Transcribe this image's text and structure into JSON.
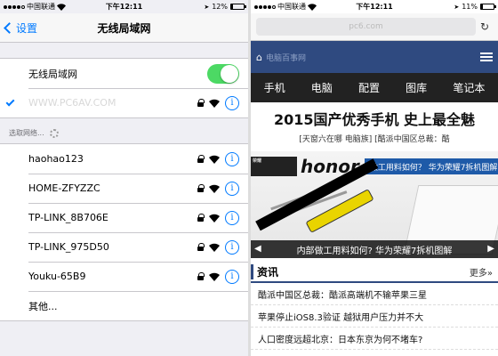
{
  "left": {
    "status": {
      "carrier": "中国联通",
      "time": "下午12:11",
      "battery": "12%",
      "battery_level": 0.12
    },
    "nav": {
      "back": "设置",
      "title": "无线局域网"
    },
    "wifi_toggle": {
      "label": "无线局域网",
      "on": true
    },
    "connected": {
      "name": "WWW.PC6AV.COM"
    },
    "choose_header": "选取网络...",
    "networks": [
      {
        "name": "haohao123"
      },
      {
        "name": "HOME-ZFYZZC"
      },
      {
        "name": "TP-LINK_8B706E"
      },
      {
        "name": "TP-LINK_975D50"
      },
      {
        "name": "Youku-65B9"
      }
    ],
    "other": "其他...",
    "icons": {
      "lock": "lock-icon",
      "wifi": "wifi-icon",
      "info": "info-icon"
    },
    "colors": {
      "accent": "#007aff",
      "toggle_on": "#4cd964"
    }
  },
  "right": {
    "status": {
      "carrier": "中国联通",
      "time": "下午12:11",
      "battery": "11%",
      "battery_level": 0.11
    },
    "url": "pc6.com",
    "site_logo": "电脑百事网",
    "nav_items": [
      "手机",
      "电脑",
      "配置",
      "图库",
      "笔记本"
    ],
    "headline": "2015国产优秀手机 史上最全魅",
    "subline": "[天窗六在哪 电脑族] [酷派中国区总裁：酷",
    "banner": {
      "brand_small": "荣耀",
      "brand": "honor",
      "ad_text": "做工用料如何？ 华为荣耀7拆机图解",
      "caption": "内部做工用料如何? 华为荣耀7拆机图解"
    },
    "section": {
      "title": "资讯",
      "more": "更多»"
    },
    "news": [
      "酷派中国区总裁：酷派高端机不输苹果三星",
      "苹果停止iOS8.3验证 越狱用户压力并不大",
      "人口密度远超北京：日本东京为何不堵车?"
    ],
    "colors": {
      "brand": "#2f4a80",
      "nav_bg": "#222222"
    }
  }
}
